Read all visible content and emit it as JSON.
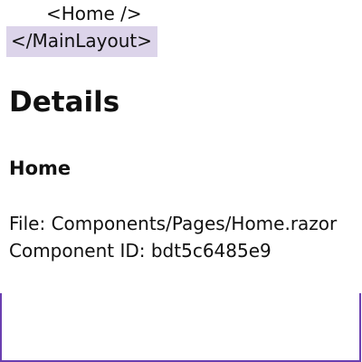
{
  "component_tree": {
    "items": [
      {
        "label": "<Home />"
      },
      {
        "label": "</MainLayout>",
        "selected": true
      }
    ]
  },
  "details": {
    "heading": "Details",
    "component_name": "Home",
    "file_line": "File: Components/Pages/Home.razor",
    "id_line": "Component ID: bdt5c6485e9"
  },
  "colors": {
    "selection_background": "#dcd4ea",
    "frame_border": "#6a3fb0"
  }
}
